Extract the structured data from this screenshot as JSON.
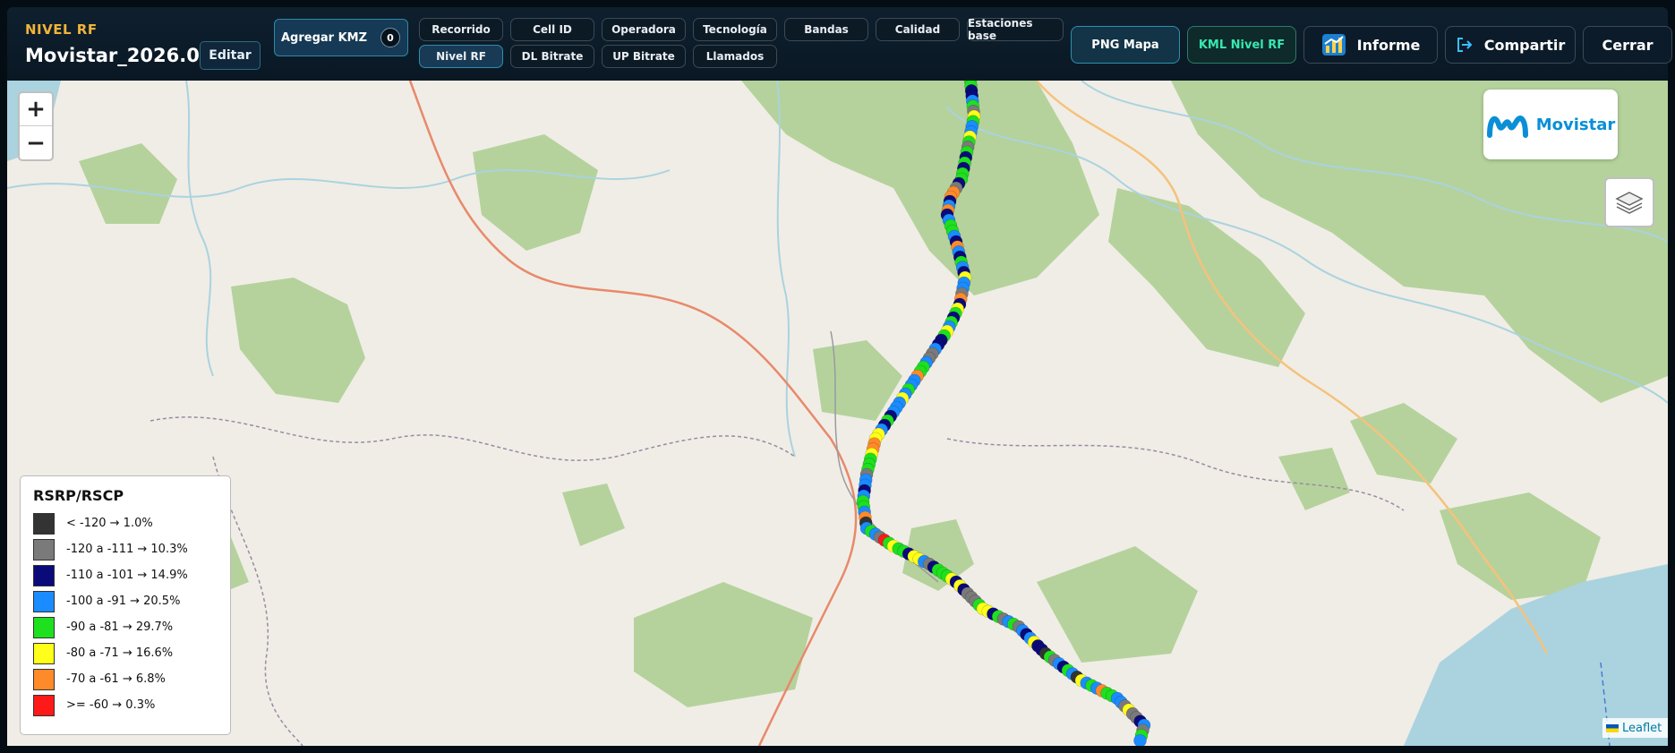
{
  "header": {
    "mode_label": "NIVEL RF",
    "file_title": "Movistar_2026.0...",
    "edit_label": "Editar",
    "kmz_label": "Agregar KMZ",
    "kmz_count": "0"
  },
  "tabs": [
    {
      "label": "Recorrido",
      "active": false
    },
    {
      "label": "Cell ID",
      "active": false
    },
    {
      "label": "Operadora",
      "active": false
    },
    {
      "label": "Tecnología",
      "active": false
    },
    {
      "label": "Bandas",
      "active": false
    },
    {
      "label": "Calidad",
      "active": false
    },
    {
      "label": "Estaciones base",
      "active": false
    },
    {
      "label": "Nivel RF",
      "active": true
    },
    {
      "label": "DL Bitrate",
      "active": false
    },
    {
      "label": "UP Bitrate",
      "active": false
    },
    {
      "label": "Llamados",
      "active": false
    }
  ],
  "actions": {
    "png": "PNG Mapa",
    "kml": "KML Nivel RF",
    "report": "Informe",
    "share": "Compartir",
    "close": "Cerrar"
  },
  "map": {
    "zoom_in": "+",
    "zoom_out": "−",
    "brand": "Movistar",
    "attribution": "Leaflet",
    "colors": {
      "land": "#f0ede6",
      "forest": "#b5d29c",
      "water": "#aad3df",
      "road_primary": "#e8896b",
      "road_secondary": "#f5c27c",
      "boundary": "#9a8aa4"
    }
  },
  "legend": {
    "title": "RSRP/RSCP",
    "items": [
      {
        "label": "< -120 → 1.0%",
        "color": "#333333"
      },
      {
        "label": "-120 a -111 → 10.3%",
        "color": "#7a7a7a"
      },
      {
        "label": "-110 a -101 → 14.9%",
        "color": "#0a0a7a"
      },
      {
        "label": "-100 a -91 → 20.5%",
        "color": "#1a8cff"
      },
      {
        "label": "-90 a -81 → 29.7%",
        "color": "#1ee01e"
      },
      {
        "label": "-80 a -71 → 16.6%",
        "color": "#ffff1a"
      },
      {
        "label": "-70 a -61 → 6.8%",
        "color": "#ff8a2a"
      },
      {
        "label": ">= -60 → 0.3%",
        "color": "#ff1a1a"
      }
    ]
  }
}
